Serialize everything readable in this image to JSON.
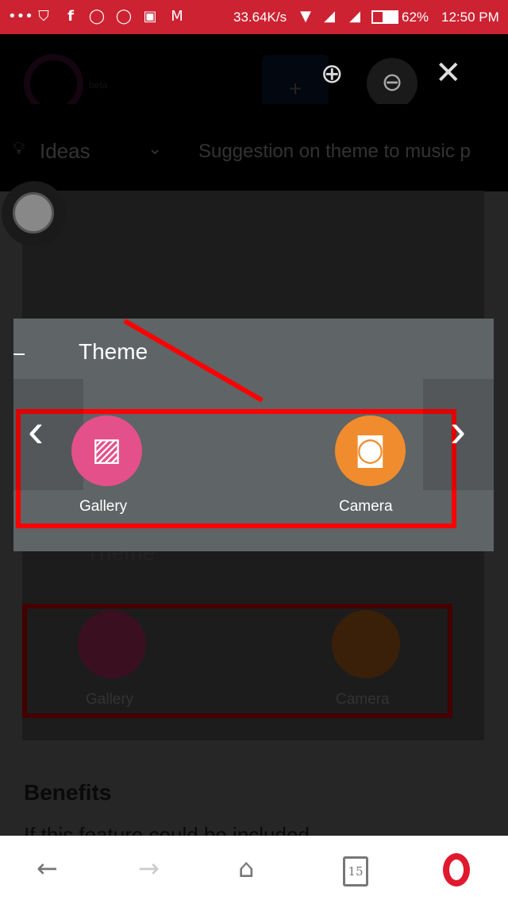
{
  "status_bar": {
    "speed": "33.64K/s",
    "battery": "62%",
    "time": "12:50 PM",
    "icons": [
      "more-icon",
      "shield-icon",
      "facebook-icon",
      "messenger-icon",
      "whatsapp-icon",
      "gallery-icon",
      "gmail-icon",
      "wifi-icon",
      "signal-icon",
      "battery-icon"
    ]
  },
  "header": {
    "logo_badge": "beta",
    "add_label": "+"
  },
  "breadcrumb": {
    "category": "Ideas",
    "title": "Suggestion on theme to music p"
  },
  "overlay": {
    "title": "Theme",
    "gallery_label": "Gallery",
    "camera_label": "Camera"
  },
  "background": {
    "title": "Theme",
    "gallery_label": "Gallery",
    "camera_label": "Camera",
    "heading": "Benefits",
    "body": "If this feature could be included"
  },
  "bottom_nav": {
    "tabs_count": "15"
  },
  "colors": {
    "status": "#cc2232",
    "gallery": "#e4508a",
    "camera": "#f08c2e",
    "highlight": "#ff0000"
  }
}
